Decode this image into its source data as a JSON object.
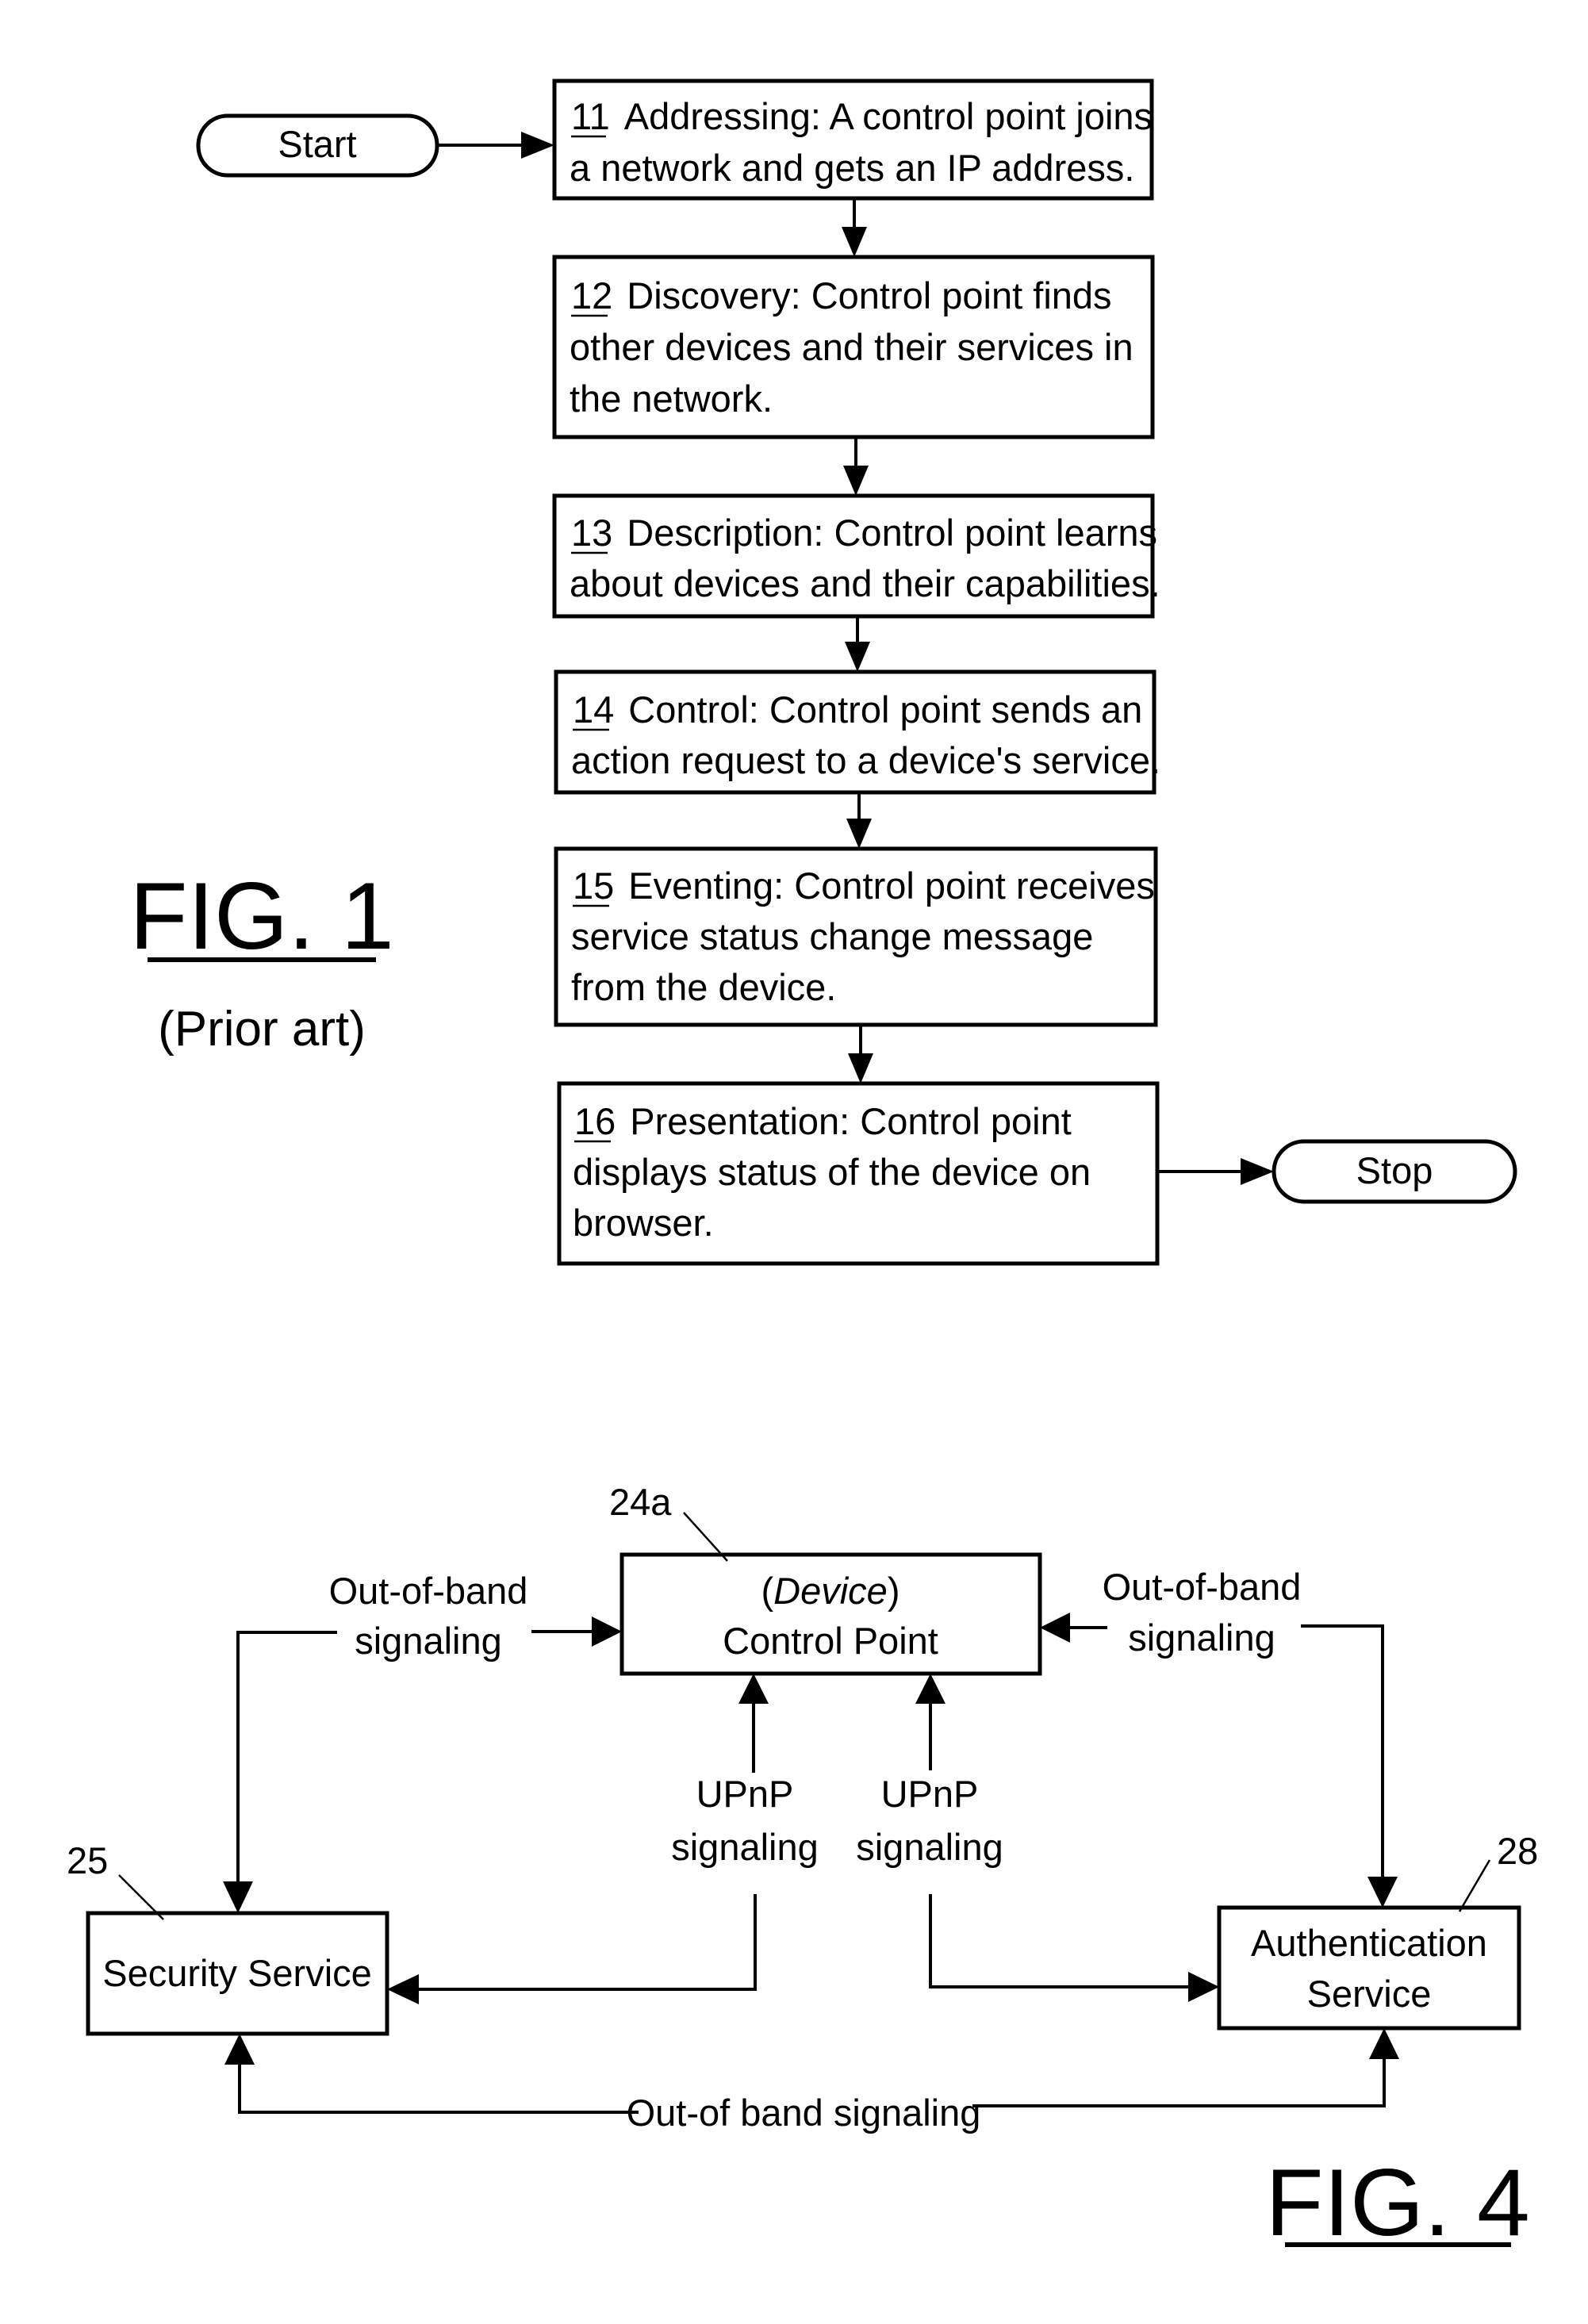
{
  "fig1": {
    "title": "FIG. 1",
    "subtitle": "(Prior art)",
    "start_label": "Start",
    "stop_label": "Stop",
    "steps": [
      {
        "num": "11",
        "lines": [
          "Addressing: A control point joins",
          "a network and gets an IP address."
        ]
      },
      {
        "num": "12",
        "lines": [
          "Discovery: Control point finds",
          "other devices and their services in",
          "the network."
        ]
      },
      {
        "num": "13",
        "lines": [
          "Description: Control point learns",
          "about devices and their capabilities."
        ]
      },
      {
        "num": "14",
        "lines": [
          "Control: Control point sends an",
          "action request to a device's service."
        ]
      },
      {
        "num": "15",
        "lines": [
          "Eventing: Control point receives",
          "service status change message",
          "from the device."
        ]
      },
      {
        "num": "16",
        "lines": [
          "Presentation: Control point",
          "displays status of the device on",
          "browser."
        ]
      }
    ]
  },
  "fig4": {
    "title": "FIG. 4",
    "control_point": {
      "ref": "24a",
      "line1_open": "(",
      "line1_italic": "Device",
      "line1_close": ")",
      "line2": "Control Point"
    },
    "security_service": {
      "ref": "25",
      "label": "Security Service"
    },
    "auth_service": {
      "ref": "28",
      "line1": "Authentication",
      "line2": "Service"
    },
    "oob_left": [
      "Out-of-band",
      "signaling"
    ],
    "oob_right": [
      "Out-of-band",
      "signaling"
    ],
    "upnp_left": [
      "UPnP",
      "signaling"
    ],
    "upnp_right": [
      "UPnP",
      "signaling"
    ],
    "oob_bottom": "Out-of band signaling"
  }
}
